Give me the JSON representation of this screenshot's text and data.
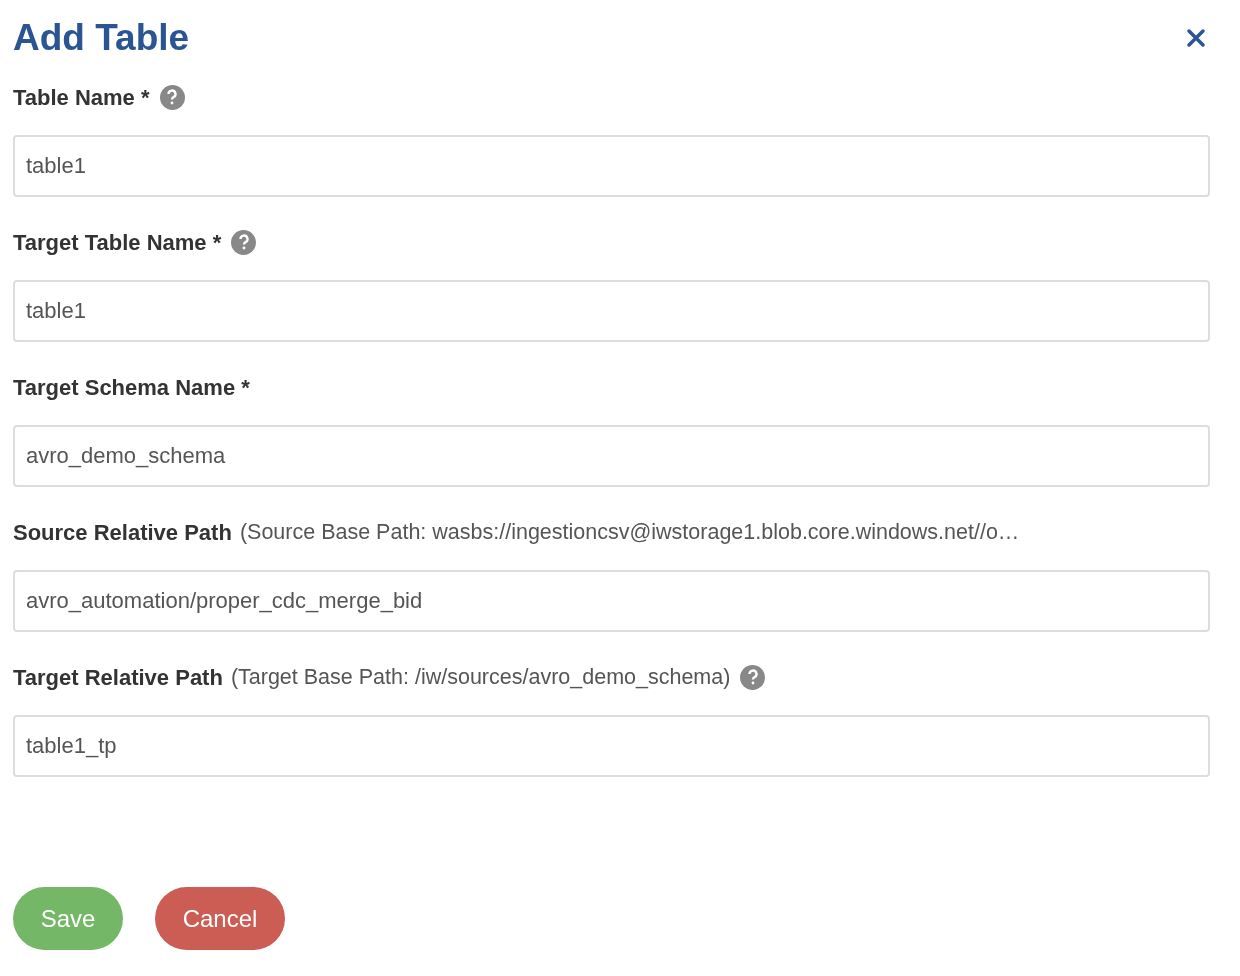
{
  "dialog": {
    "title": "Add Table"
  },
  "fields": [
    {
      "label": "Table Name *",
      "help": true,
      "value": "table1"
    },
    {
      "label": "Target Table Name *",
      "help": true,
      "value": "table1"
    },
    {
      "label": "Target Schema Name *",
      "help": false,
      "value": "avro_demo_schema"
    },
    {
      "label": "Source Relative Path",
      "note": "(Source Base Path: wasbs://ingestioncsv@iwstorage1.blob.core.windows.net//o…",
      "help": false,
      "value": "avro_automation/proper_cdc_merge_bid"
    },
    {
      "label": "Target Relative Path",
      "note": "(Target Base Path: /iw/sources/avro_demo_schema)",
      "help": true,
      "value": "table1_tp"
    }
  ],
  "buttons": [
    {
      "label": "Save",
      "kind": "primary"
    },
    {
      "label": "Cancel",
      "kind": "danger"
    }
  ]
}
